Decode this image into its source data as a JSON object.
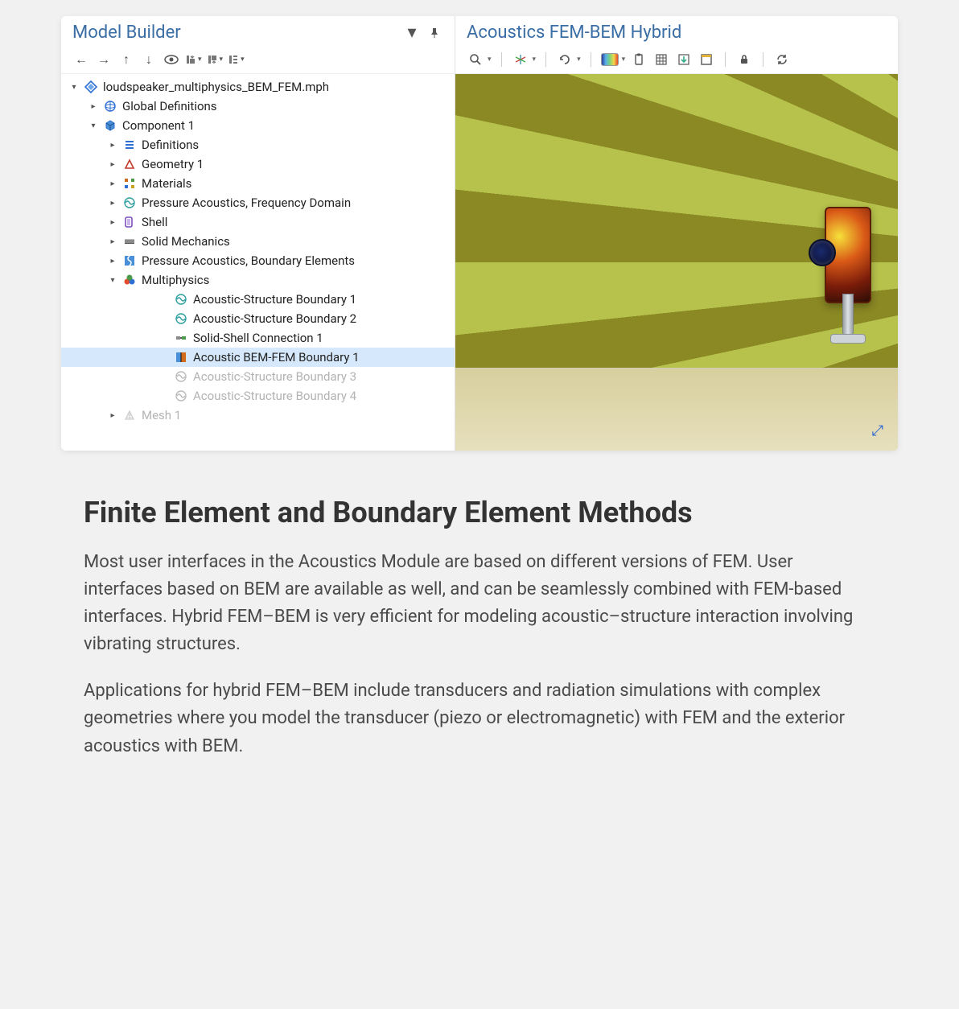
{
  "left": {
    "title": "Model Builder",
    "toolbar": {
      "back": "←",
      "fwd": "→",
      "up": "↑",
      "down": "↓"
    }
  },
  "right": {
    "title": "Acoustics FEM-BEM Hybrid"
  },
  "tree": [
    {
      "depth": 0,
      "twisty": "▾",
      "icon": "diamond",
      "label": "loudspeaker_multiphysics_BEM_FEM.mph",
      "selected": false,
      "disabled": false
    },
    {
      "depth": 1,
      "twisty": "▸",
      "icon": "globe",
      "label": "Global Definitions",
      "selected": false,
      "disabled": false
    },
    {
      "depth": 1,
      "twisty": "▾",
      "icon": "cube",
      "label": "Component 1",
      "selected": false,
      "disabled": false
    },
    {
      "depth": 2,
      "twisty": "▸",
      "icon": "list",
      "label": "Definitions",
      "selected": false,
      "disabled": false
    },
    {
      "depth": 2,
      "twisty": "▸",
      "icon": "shape",
      "label": "Geometry 1",
      "selected": false,
      "disabled": false
    },
    {
      "depth": 2,
      "twisty": "▸",
      "icon": "grid",
      "label": "Materials",
      "selected": false,
      "disabled": false
    },
    {
      "depth": 2,
      "twisty": "▸",
      "icon": "wave",
      "label": "Pressure Acoustics, Frequency Domain",
      "selected": false,
      "disabled": false
    },
    {
      "depth": 2,
      "twisty": "▸",
      "icon": "shell",
      "label": "Shell",
      "selected": false,
      "disabled": false
    },
    {
      "depth": 2,
      "twisty": "▸",
      "icon": "solid",
      "label": "Solid Mechanics",
      "selected": false,
      "disabled": false
    },
    {
      "depth": 2,
      "twisty": "▸",
      "icon": "bem",
      "label": "Pressure Acoustics, Boundary Elements",
      "selected": false,
      "disabled": false
    },
    {
      "depth": 2,
      "twisty": "▾",
      "icon": "multi",
      "label": "Multiphysics",
      "selected": false,
      "disabled": false
    },
    {
      "depth": 4,
      "twisty": "",
      "icon": "wave",
      "label": "Acoustic-Structure Boundary 1",
      "selected": false,
      "disabled": false
    },
    {
      "depth": 4,
      "twisty": "",
      "icon": "wave",
      "label": "Acoustic-Structure Boundary 2",
      "selected": false,
      "disabled": false
    },
    {
      "depth": 4,
      "twisty": "",
      "icon": "conn",
      "label": "Solid-Shell Connection 1",
      "selected": false,
      "disabled": false
    },
    {
      "depth": 4,
      "twisty": "",
      "icon": "bemfem",
      "label": "Acoustic BEM-FEM Boundary 1",
      "selected": true,
      "disabled": false
    },
    {
      "depth": 4,
      "twisty": "",
      "icon": "wave",
      "label": "Acoustic-Structure Boundary 3",
      "selected": false,
      "disabled": true
    },
    {
      "depth": 4,
      "twisty": "",
      "icon": "wave",
      "label": "Acoustic-Structure Boundary 4",
      "selected": false,
      "disabled": true
    },
    {
      "depth": 2,
      "twisty": "▸",
      "icon": "mesh",
      "label": "Mesh 1",
      "selected": false,
      "disabled": true
    }
  ],
  "article": {
    "heading": "Finite Element and Boundary Element Methods",
    "p1": "Most user interfaces in the Acoustics Module are based on different versions of FEM. User interfaces based on BEM are available as well, and can be seamlessly combined with FEM-based interfaces. Hybrid FEM–BEM is very efficient for modeling acoustic–structure interaction involving vibrating structures.",
    "p2": "Applications for hybrid FEM–BEM include transducers and radiation simulations with complex geometries where you model the transducer (piezo or electromagnetic) with FEM and the exterior acoustics with BEM."
  }
}
